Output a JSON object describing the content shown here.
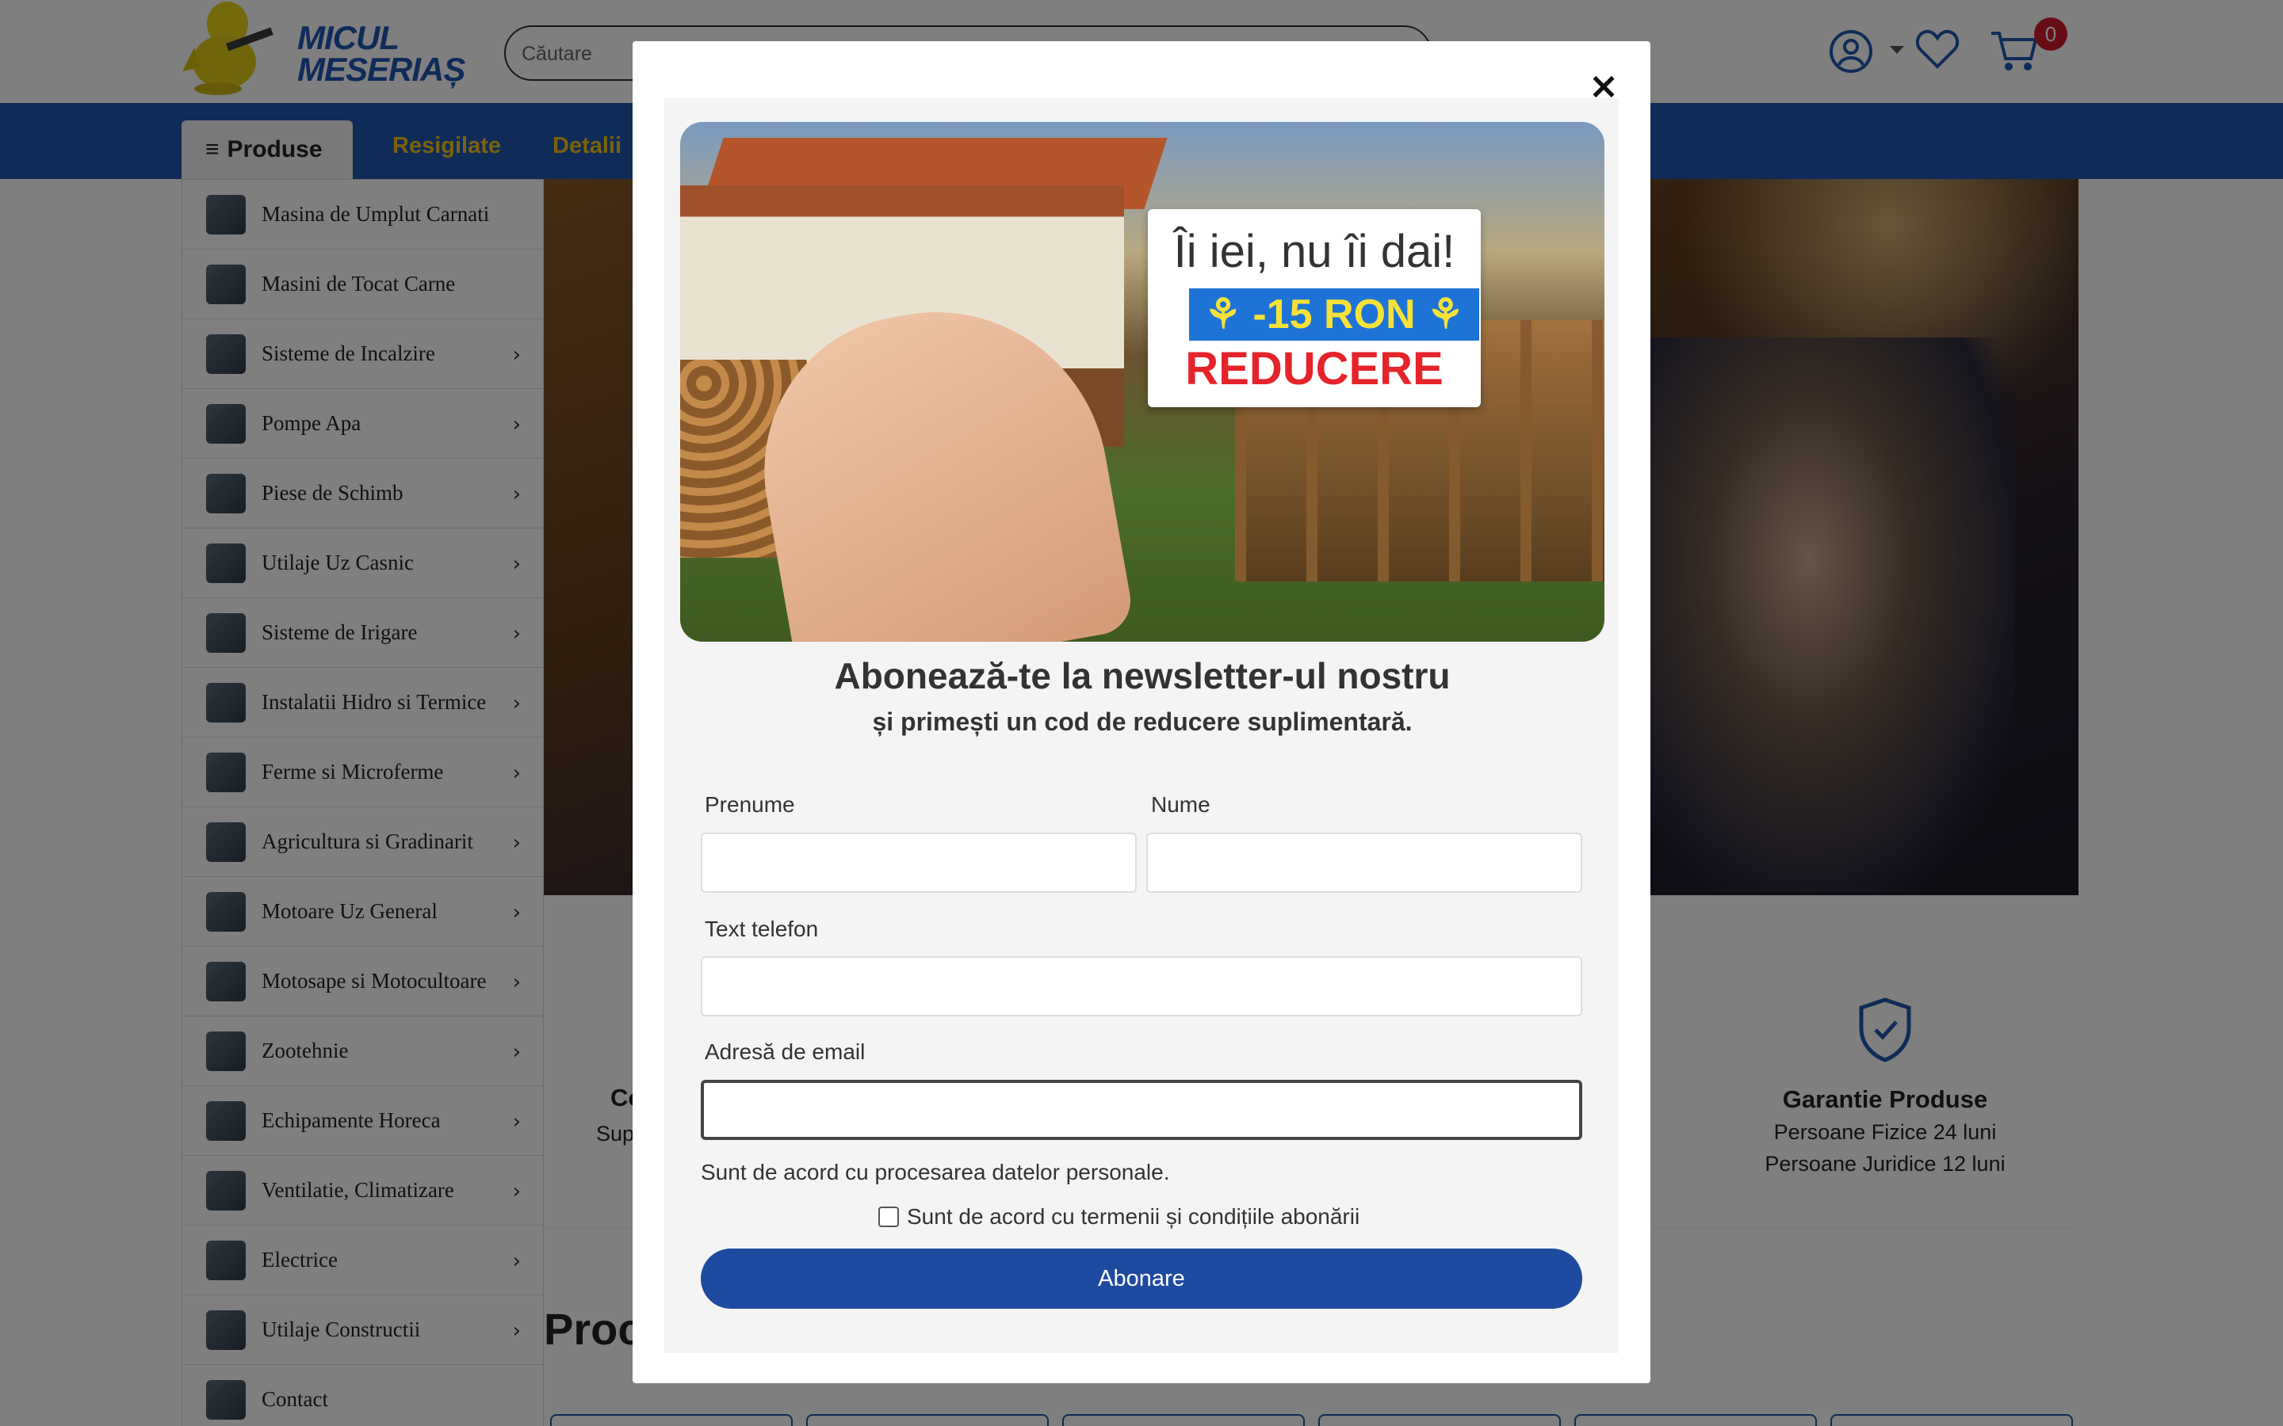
{
  "header": {
    "logo_line1": "MICUL",
    "logo_line2": "MESERIAȘ",
    "search_placeholder": "Căutare",
    "cart_count": "0"
  },
  "nav": {
    "produse_label": "Produse",
    "links": [
      "Resigilate",
      "Detalii"
    ]
  },
  "sidebar": {
    "items": [
      {
        "label": "Masina de Umplut Carnati",
        "has_arrow": false
      },
      {
        "label": "Masini de Tocat Carne",
        "has_arrow": false
      },
      {
        "label": "Sisteme de Incalzire",
        "has_arrow": true
      },
      {
        "label": "Pompe Apa",
        "has_arrow": true
      },
      {
        "label": "Piese de Schimb",
        "has_arrow": true
      },
      {
        "label": "Utilaje Uz Casnic",
        "has_arrow": true
      },
      {
        "label": "Sisteme de Irigare",
        "has_arrow": true
      },
      {
        "label": "Instalatii Hidro si Termice",
        "has_arrow": true
      },
      {
        "label": "Ferme si Microferme",
        "has_arrow": true
      },
      {
        "label": "Agricultura si Gradinarit",
        "has_arrow": true
      },
      {
        "label": "Motoare Uz General",
        "has_arrow": true
      },
      {
        "label": "Motosape si Motocultoare",
        "has_arrow": true
      },
      {
        "label": "Zootehnie",
        "has_arrow": true
      },
      {
        "label": "Echipamente Horeca",
        "has_arrow": true
      },
      {
        "label": "Ventilatie, Climatizare",
        "has_arrow": true
      },
      {
        "label": "Electrice",
        "has_arrow": true
      },
      {
        "label": "Utilaje Constructii",
        "has_arrow": true
      },
      {
        "label": "Contact",
        "has_arrow": false
      }
    ]
  },
  "features": {
    "left_title_partial": "Co",
    "left_line_partial": "Sup",
    "warranty_title": "Garantie Produse",
    "warranty_line1": "Persoane Fizice 24 luni",
    "warranty_line2": "Persoane Juridice 12 luni"
  },
  "products_heading_partial": "Proc",
  "modal": {
    "close_symbol": "×",
    "promo_line1": "Îi iei, nu îi dai!",
    "promo_line2": "⚘ -15 RON ⚘",
    "promo_line3": "REDUCERE",
    "title": "Abonează-te la newsletter-ul nostru",
    "subtitle": "și primești un cod de reducere suplimentară.",
    "fields": {
      "first_name_label": "Prenume",
      "last_name_label": "Nume",
      "phone_label": "Text telefon",
      "email_label": "Adresă de email"
    },
    "consent_text": "Sunt de acord cu procesarea datelor personale.",
    "terms_checkbox_label": "Sunt de acord cu termenii și condițiile abonării",
    "submit_label": "Abonare"
  },
  "colors": {
    "brand_blue": "#1e56b0",
    "nav_link_yellow": "#f5c518",
    "submit_blue": "#1e4aa0",
    "badge_red": "#d11a2a"
  }
}
